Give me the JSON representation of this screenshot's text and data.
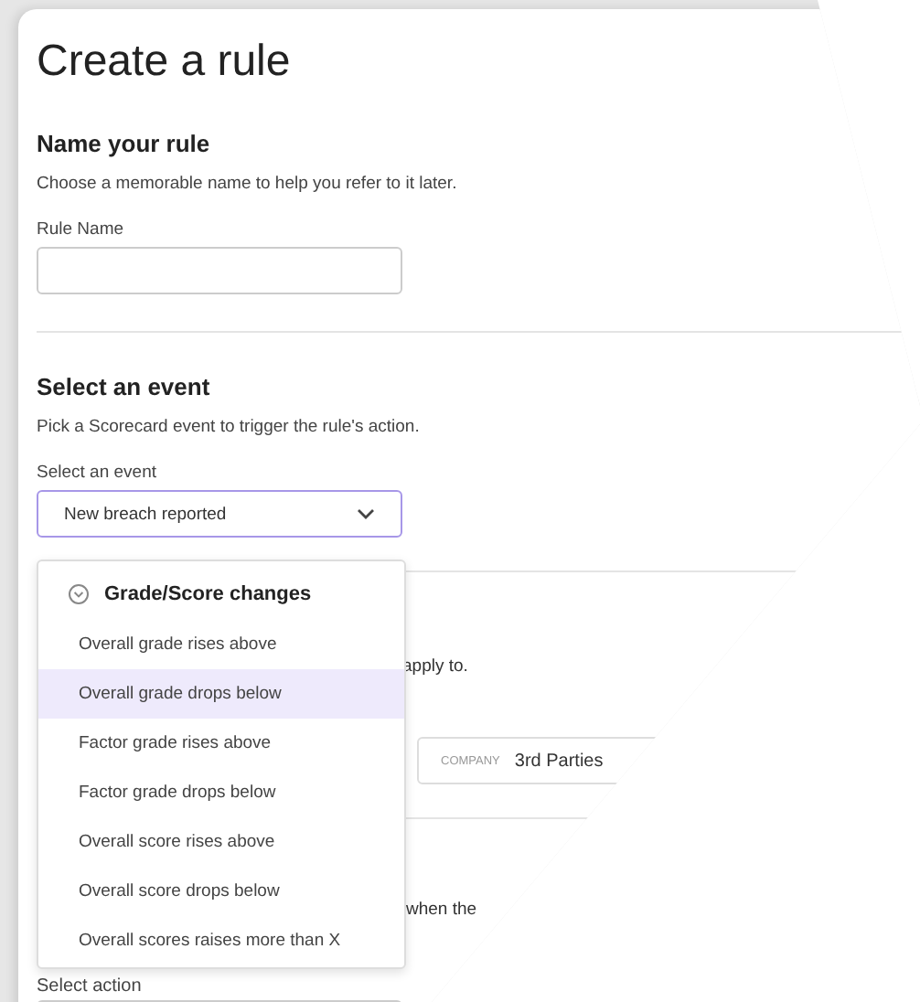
{
  "title": "Create a rule",
  "name_section": {
    "heading": "Name your rule",
    "description": "Choose a memorable name to help you refer to it later.",
    "field_label": "Rule Name"
  },
  "event_section": {
    "heading": "Select an event",
    "description": "Pick a Scorecard event to trigger the rule's action.",
    "field_label": "Select an event",
    "value": "New breach reported"
  },
  "dropdown": {
    "group": "Grade/Score changes",
    "items": [
      {
        "label": "Overall grade rises above",
        "selected": false
      },
      {
        "label": "Overall grade drops below",
        "selected": true
      },
      {
        "label": "Factor grade rises above",
        "selected": false
      },
      {
        "label": "Factor grade drops below",
        "selected": false
      },
      {
        "label": "Overall score rises above",
        "selected": false
      },
      {
        "label": "Overall score drops below",
        "selected": false
      },
      {
        "label": "Overall scores raises more than X",
        "selected": false
      }
    ]
  },
  "companies_section": {
    "description_tail": "apply to.",
    "company_field": {
      "tag": "COMPANY",
      "value": "3rd Parties"
    }
  },
  "action_section": {
    "description_tail": "when the",
    "field_label": "Select action"
  }
}
